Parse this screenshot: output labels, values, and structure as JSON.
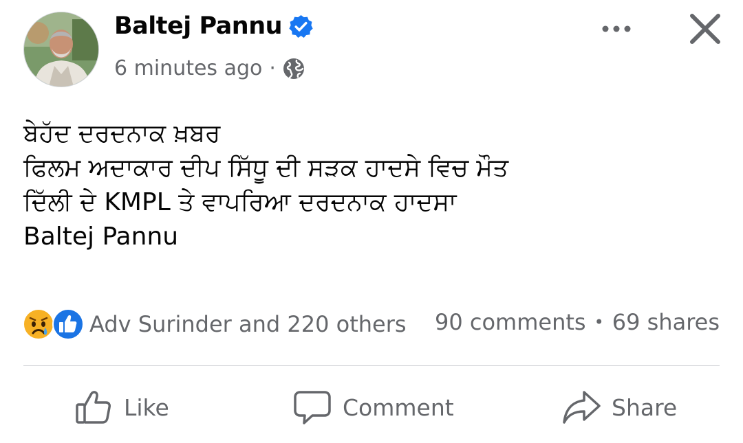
{
  "post": {
    "author": "Baltej Pannu",
    "timestamp": "6 minutes ago",
    "separator": "·",
    "audience_icon": "globe-icon",
    "verified_icon": "verified-badge-icon",
    "text_lines": [
      "ਬੇਹੱਦ ਦਰਦਨਾਕ ਖ਼ਬਰ",
      "ਫਿਲਮ ਅਦਾਕਾਰ ਦੀਪ ਸਿੱਧੂ ਦੀ ਸੜਕ ਹਾਦਸੇ ਵਿਚ ਮੌਤ",
      "ਦਿੱਲੀ ਦੇ KMPL ਤੇ ਵਾਪਰਿਆ ਦਰਦਨਾਕ ਹਾਦਸਾ",
      "Baltej Pannu"
    ]
  },
  "reactions": {
    "icons": [
      "sad-reaction-icon",
      "like-reaction-icon"
    ],
    "summary": "Adv Surinder and 220 others"
  },
  "stats": {
    "comments": "90 comments",
    "separator": "•",
    "shares": "69 shares"
  },
  "actions": {
    "like": "Like",
    "comment": "Comment",
    "share": "Share"
  },
  "colors": {
    "verified": "#1877f2",
    "secondary_text": "#65676b",
    "divider": "#ced0d4"
  }
}
